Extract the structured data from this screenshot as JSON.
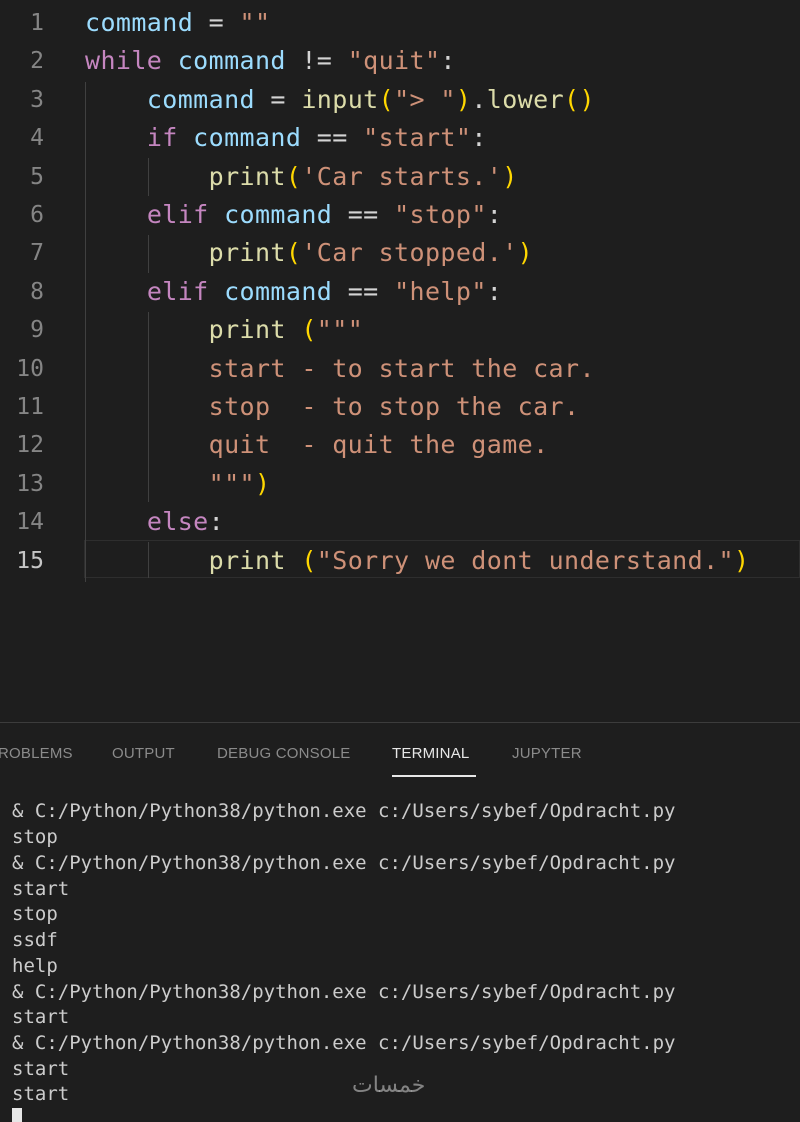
{
  "editor": {
    "line_numbers": [
      "1",
      "2",
      "3",
      "4",
      "5",
      "6",
      "7",
      "8",
      "9",
      "10",
      "11",
      "12",
      "13",
      "14",
      "15"
    ],
    "lines": [
      [
        {
          "t": "command",
          "c": "var"
        },
        {
          "t": " = ",
          "c": "op"
        },
        {
          "t": "\"\"",
          "c": "str"
        }
      ],
      [
        {
          "t": "while",
          "c": "kw"
        },
        {
          "t": " ",
          "c": "op"
        },
        {
          "t": "command",
          "c": "var"
        },
        {
          "t": " != ",
          "c": "op"
        },
        {
          "t": "\"quit\"",
          "c": "str"
        },
        {
          "t": ":",
          "c": "op"
        }
      ],
      [
        {
          "t": "    ",
          "c": "op"
        },
        {
          "t": "command",
          "c": "var"
        },
        {
          "t": " = ",
          "c": "op"
        },
        {
          "t": "input",
          "c": "fn"
        },
        {
          "t": "(",
          "c": "br"
        },
        {
          "t": "\"> \"",
          "c": "str"
        },
        {
          "t": ")",
          "c": "br"
        },
        {
          "t": ".",
          "c": "op"
        },
        {
          "t": "lower",
          "c": "fn"
        },
        {
          "t": "()",
          "c": "br"
        }
      ],
      [
        {
          "t": "    ",
          "c": "op"
        },
        {
          "t": "if",
          "c": "kw"
        },
        {
          "t": " ",
          "c": "op"
        },
        {
          "t": "command",
          "c": "var"
        },
        {
          "t": " == ",
          "c": "op"
        },
        {
          "t": "\"start\"",
          "c": "str"
        },
        {
          "t": ":",
          "c": "op"
        }
      ],
      [
        {
          "t": "        ",
          "c": "op"
        },
        {
          "t": "print",
          "c": "fn"
        },
        {
          "t": "(",
          "c": "br"
        },
        {
          "t": "'Car starts.'",
          "c": "str"
        },
        {
          "t": ")",
          "c": "br"
        }
      ],
      [
        {
          "t": "    ",
          "c": "op"
        },
        {
          "t": "elif",
          "c": "kw"
        },
        {
          "t": " ",
          "c": "op"
        },
        {
          "t": "command",
          "c": "var"
        },
        {
          "t": " == ",
          "c": "op"
        },
        {
          "t": "\"stop\"",
          "c": "str"
        },
        {
          "t": ":",
          "c": "op"
        }
      ],
      [
        {
          "t": "        ",
          "c": "op"
        },
        {
          "t": "print",
          "c": "fn"
        },
        {
          "t": "(",
          "c": "br"
        },
        {
          "t": "'Car stopped.'",
          "c": "str"
        },
        {
          "t": ")",
          "c": "br"
        }
      ],
      [
        {
          "t": "    ",
          "c": "op"
        },
        {
          "t": "elif",
          "c": "kw"
        },
        {
          "t": " ",
          "c": "op"
        },
        {
          "t": "command",
          "c": "var"
        },
        {
          "t": " == ",
          "c": "op"
        },
        {
          "t": "\"help\"",
          "c": "str"
        },
        {
          "t": ":",
          "c": "op"
        }
      ],
      [
        {
          "t": "        ",
          "c": "op"
        },
        {
          "t": "print",
          "c": "fn"
        },
        {
          "t": " ",
          "c": "op"
        },
        {
          "t": "(",
          "c": "br"
        },
        {
          "t": "\"\"\"",
          "c": "str"
        }
      ],
      [
        {
          "t": "        ",
          "c": "op"
        },
        {
          "t": "start - to start the car.",
          "c": "str"
        }
      ],
      [
        {
          "t": "        ",
          "c": "op"
        },
        {
          "t": "stop  - to stop the car.",
          "c": "str"
        }
      ],
      [
        {
          "t": "        ",
          "c": "op"
        },
        {
          "t": "quit  - quit the game.",
          "c": "str"
        }
      ],
      [
        {
          "t": "        ",
          "c": "op"
        },
        {
          "t": "\"\"\"",
          "c": "str"
        },
        {
          "t": ")",
          "c": "br"
        }
      ],
      [
        {
          "t": "    ",
          "c": "op"
        },
        {
          "t": "else",
          "c": "kw"
        },
        {
          "t": ":",
          "c": "op"
        }
      ],
      [
        {
          "t": "        ",
          "c": "op"
        },
        {
          "t": "print",
          "c": "fn"
        },
        {
          "t": " ",
          "c": "op"
        },
        {
          "t": "(",
          "c": "br"
        },
        {
          "t": "\"Sorry we dont understand.\"",
          "c": "str"
        },
        {
          "t": ")",
          "c": "br"
        }
      ]
    ],
    "active_line": "15"
  },
  "panel": {
    "tabs": [
      {
        "label": "ROBLEMS",
        "active": false
      },
      {
        "label": "OUTPUT",
        "active": false
      },
      {
        "label": "DEBUG CONSOLE",
        "active": false
      },
      {
        "label": "TERMINAL",
        "active": true
      },
      {
        "label": "JUPYTER",
        "active": false
      }
    ],
    "terminal_lines": [
      "& C:/Python/Python38/python.exe c:/Users/sybef/Opdracht.py",
      "stop",
      "& C:/Python/Python38/python.exe c:/Users/sybef/Opdracht.py",
      "start",
      "stop",
      "ssdf",
      "help",
      "& C:/Python/Python38/python.exe c:/Users/sybef/Opdracht.py",
      "start",
      "& C:/Python/Python38/python.exe c:/Users/sybef/Opdracht.py",
      "start",
      "start"
    ]
  },
  "watermark": "خمسات",
  "colors": {
    "keyword": "#c586c0",
    "variable": "#9cdcfe",
    "function": "#dcdcaa",
    "string": "#ce9178",
    "bracket": "#ffd700",
    "background": "#1e1e1e"
  }
}
